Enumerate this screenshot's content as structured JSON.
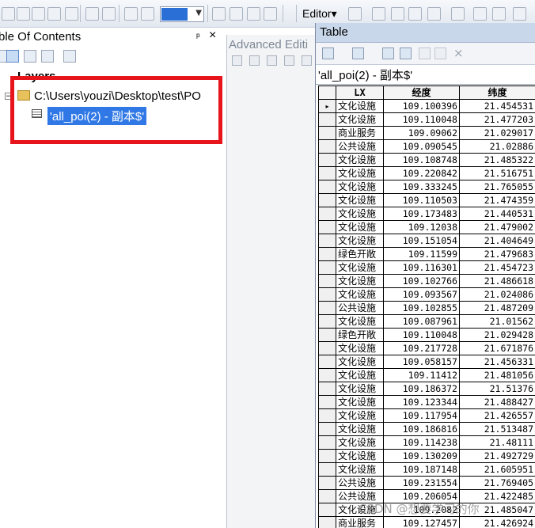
{
  "toolbar": {
    "editor_label": "Editor",
    "editor_dropdown_glyph": "▾"
  },
  "toc": {
    "title": "ble Of Contents",
    "pin_glyph": "ᵖ",
    "close_glyph": "×",
    "layers_label": "Layers",
    "folder_path": "C:\\Users\\youzi\\Desktop\\test\\PO",
    "selected_table": "'all_poi(2) - 副本$'",
    "collapse_glyph": "−"
  },
  "advanced_editing": {
    "title": "Advanced Editi"
  },
  "table_window": {
    "title": "Table",
    "tab_label": "'all_poi(2) - 副本$'",
    "close_glyph": "×",
    "columns": [
      "LX",
      "经度",
      "纬度"
    ],
    "current_row_glyph": "▸",
    "rows": [
      [
        "文化设施",
        "109.100396",
        "21.454531"
      ],
      [
        "文化设施",
        "109.110048",
        "21.477203"
      ],
      [
        "商业服务",
        "109.09062",
        "21.029017"
      ],
      [
        "公共设施",
        "109.090545",
        "21.02886"
      ],
      [
        "文化设施",
        "109.108748",
        "21.485322"
      ],
      [
        "文化设施",
        "109.220842",
        "21.516751"
      ],
      [
        "文化设施",
        "109.333245",
        "21.765055"
      ],
      [
        "文化设施",
        "109.110503",
        "21.474359"
      ],
      [
        "文化设施",
        "109.173483",
        "21.440531"
      ],
      [
        "文化设施",
        "109.12038",
        "21.479002"
      ],
      [
        "文化设施",
        "109.151054",
        "21.404649"
      ],
      [
        "绿色开敞",
        "109.11599",
        "21.479683"
      ],
      [
        "文化设施",
        "109.116301",
        "21.454723"
      ],
      [
        "文化设施",
        "109.102766",
        "21.486618"
      ],
      [
        "文化设施",
        "109.093567",
        "21.024086"
      ],
      [
        "公共设施",
        "109.102855",
        "21.487209"
      ],
      [
        "文化设施",
        "109.087961",
        "21.01562"
      ],
      [
        "绿色开敞",
        "109.110048",
        "21.029428"
      ],
      [
        "文化设施",
        "109.217728",
        "21.671876"
      ],
      [
        "文化设施",
        "109.058157",
        "21.456331"
      ],
      [
        "文化设施",
        "109.11412",
        "21.481056"
      ],
      [
        "文化设施",
        "109.186372",
        "21.51376"
      ],
      [
        "文化设施",
        "109.123344",
        "21.488427"
      ],
      [
        "文化设施",
        "109.117954",
        "21.426557"
      ],
      [
        "文化设施",
        "109.186816",
        "21.513487"
      ],
      [
        "文化设施",
        "109.114238",
        "21.48111"
      ],
      [
        "文化设施",
        "109.130209",
        "21.492729"
      ],
      [
        "文化设施",
        "109.187148",
        "21.605951"
      ],
      [
        "公共设施",
        "109.231554",
        "21.769405"
      ],
      [
        "公共设施",
        "109.206054",
        "21.422485"
      ],
      [
        "文化设施",
        "109.2082",
        "21.485047"
      ],
      [
        "商业服务",
        "109.127457",
        "21.426924"
      ]
    ]
  },
  "watermark": "CSDN @想要学习的你"
}
